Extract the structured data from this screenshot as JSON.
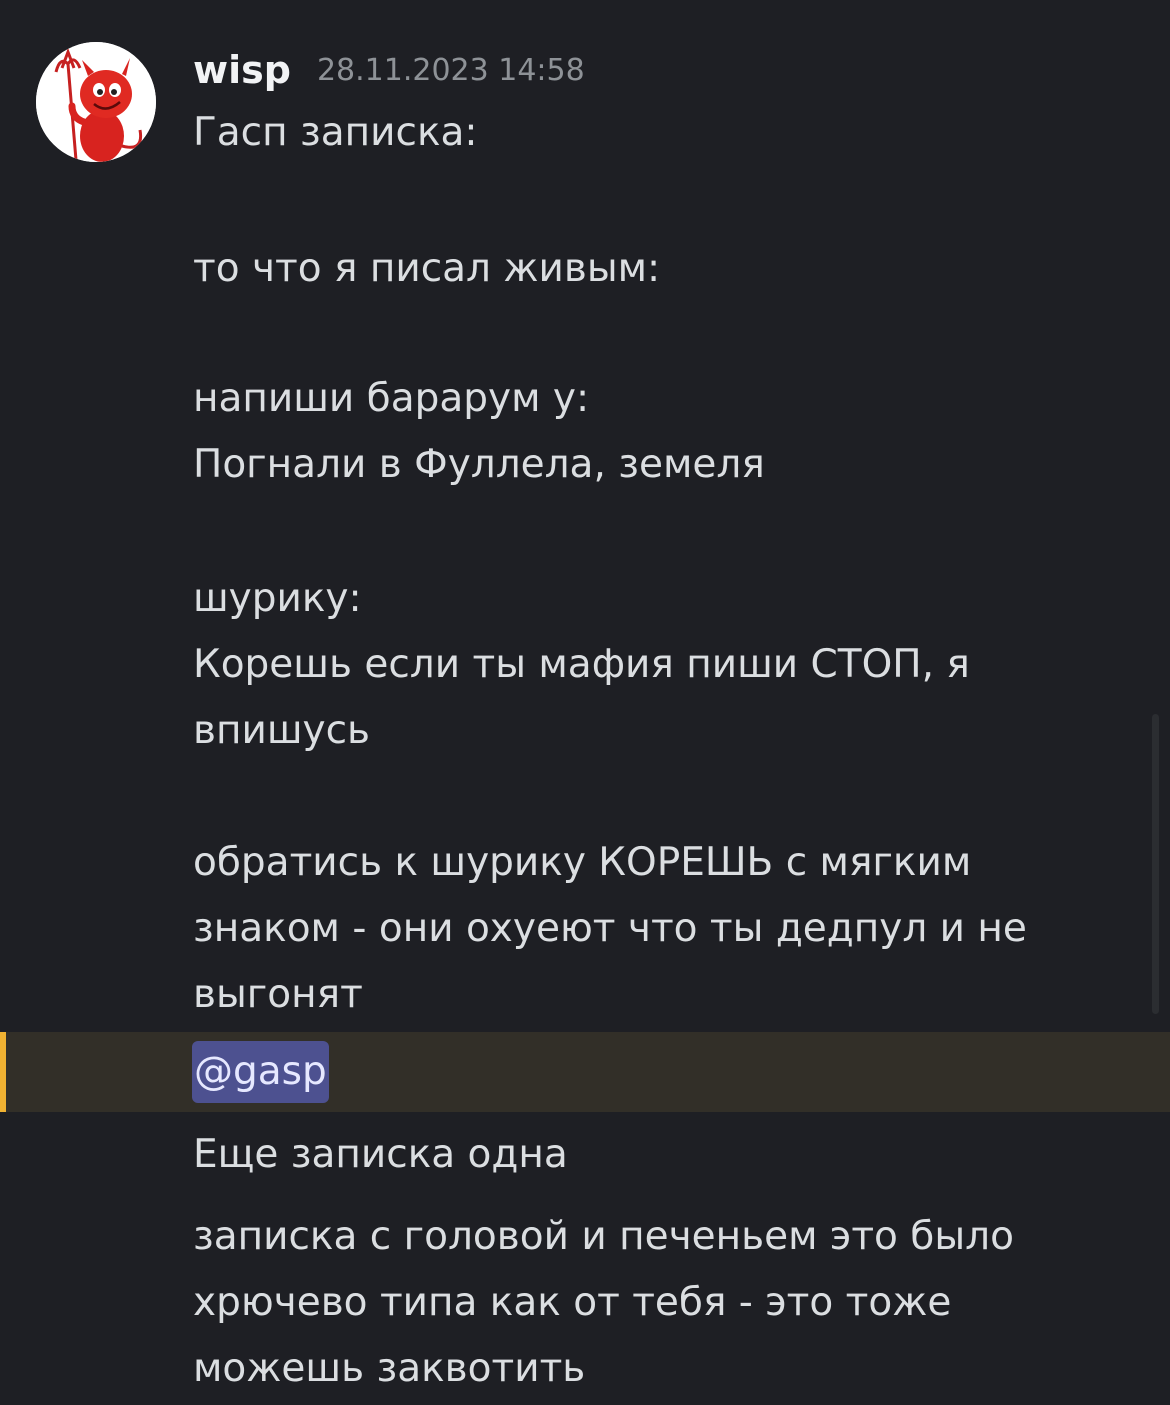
{
  "message": {
    "author": "wisp",
    "timestamp": "28.11.2023 14:58",
    "avatar_icon": "red-devil-mascot-icon",
    "lines": [
      "Гасп записка:",
      "то что я писал живым:",
      "напиши барарум у:",
      "Погнали в Фуллела, земеля",
      "шурику:",
      "Корешь если ты мафия пиши СТОП, я",
      "впишусь",
      "обратись к шурику КОРЕШЬ с мягким",
      "знаком - они охуеют что ты дедпул и не",
      "выгонят"
    ]
  },
  "mention_message": {
    "mention": "@gasp",
    "highlight_color": "#322f28",
    "bar_color": "#f0b232"
  },
  "followups": [
    "Еще записка одна",
    "записка с головой и печеньем это было",
    "хрючево типа как от тебя - это тоже",
    "можешь заквотить"
  ],
  "colors": {
    "background": "#1e1f24",
    "text": "#dbdee1",
    "mention_bg": "#4d5190"
  }
}
